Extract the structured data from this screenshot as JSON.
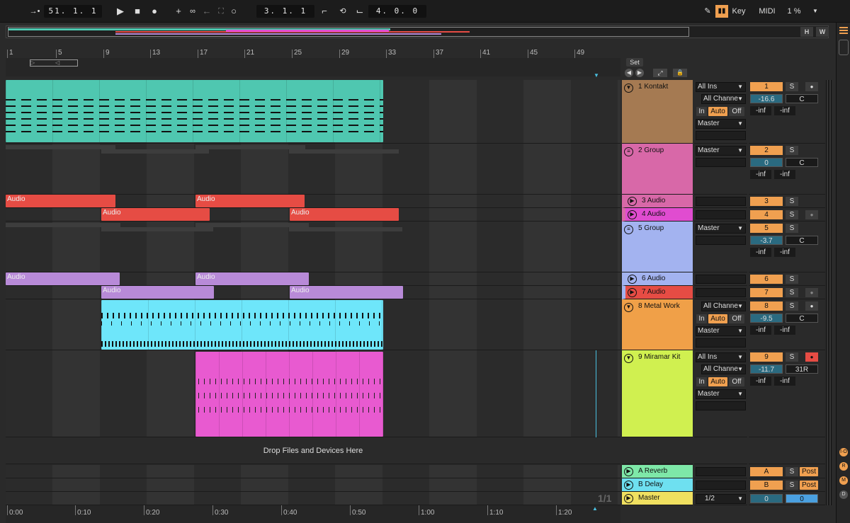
{
  "transport": {
    "arrangement_position": "51. 1. 1",
    "loop_start": "3. 1. 1",
    "loop_length": "4. 0. 0"
  },
  "controls": {
    "key_label": "Key",
    "midi_label": "MIDI",
    "cpu_load": "1 %"
  },
  "overview": {
    "h_label": "H",
    "w_label": "W"
  },
  "ruler": {
    "bars": [
      "1",
      "5",
      "9",
      "13",
      "17",
      "21",
      "25",
      "29",
      "33",
      "37",
      "41",
      "45",
      "49"
    ],
    "set_label": "Set"
  },
  "tracks": [
    {
      "number": "1",
      "name": "1 Kontakt",
      "input": "All Ins",
      "channel": "All Channe",
      "monitor": [
        "In",
        "Auto",
        "Off"
      ],
      "output": "Master",
      "volume": "-16.6",
      "pan": "C",
      "sends": [
        "-inf",
        "-inf"
      ],
      "color": "#a57a52"
    },
    {
      "number": "2",
      "name": "2 Group",
      "output": "Master",
      "volume": "0",
      "pan": "C",
      "sends": [
        "-inf",
        "-inf"
      ],
      "color": "#d868a8"
    },
    {
      "number": "3",
      "name": "3 Audio",
      "color": "#d868a8"
    },
    {
      "number": "4",
      "name": "4 Audio",
      "color": "#e04cd0"
    },
    {
      "number": "5",
      "name": "5 Group",
      "output": "Master",
      "volume": "-3.7",
      "pan": "C",
      "sends": [
        "-inf",
        "-inf"
      ],
      "color": "#a3b3f0"
    },
    {
      "number": "6",
      "name": "6 Audio",
      "color": "#a3b3f0"
    },
    {
      "number": "7",
      "name": "7 Audio",
      "color": "#e64c44"
    },
    {
      "number": "8",
      "name": "8 Metal Work",
      "channel": "All Channe",
      "monitor": [
        "In",
        "Auto",
        "Off"
      ],
      "output": "Master",
      "volume": "-9.5",
      "pan": "C",
      "sends": [
        "-inf",
        "-inf"
      ],
      "color": "#f0a048"
    },
    {
      "number": "9",
      "name": "9 Miramar Kit",
      "input": "All Ins",
      "channel": "All Channe",
      "monitor": [
        "In",
        "Auto",
        "Off"
      ],
      "output": "Master",
      "volume": "-11.7",
      "pan": "31R",
      "sends": [
        "-inf",
        "-inf"
      ],
      "color": "#d0f050"
    }
  ],
  "clips": {
    "audio_label": "Audio"
  },
  "drop_zone": "Drop Files and Devices Here",
  "returns": [
    {
      "letter": "A",
      "name": "A Reverb",
      "post": "Post",
      "color": "#7ee8a8"
    },
    {
      "letter": "B",
      "name": "B Delay",
      "post": "Post",
      "color": "#6ee0f0"
    }
  ],
  "master": {
    "name": "Master",
    "output": "1/2",
    "volume": "0",
    "pan": "0",
    "color": "#f0e060"
  },
  "solo_label": "S",
  "page_indicator": "1/1",
  "timeline": [
    "0:00",
    "0:10",
    "0:20",
    "0:30",
    "0:40",
    "0:50",
    "1:00",
    "1:10",
    "1:20"
  ],
  "sidebar_letters": [
    "I·O",
    "R",
    "M",
    "D"
  ]
}
